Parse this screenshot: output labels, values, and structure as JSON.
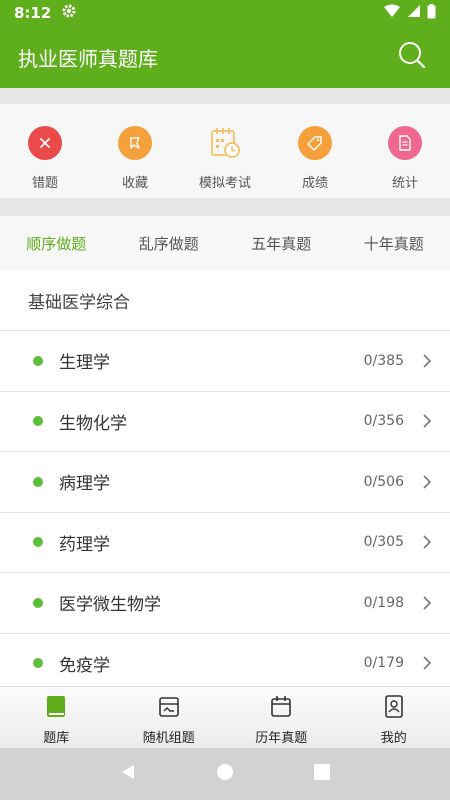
{
  "status_bar": {
    "time": "8:12"
  },
  "app_bar": {
    "title": "执业医师真题库"
  },
  "quick_actions": [
    {
      "label": "错题",
      "icon": "close-icon",
      "color": "#ea4a4a"
    },
    {
      "label": "收藏",
      "icon": "bookmark-icon",
      "color": "#f5a03a"
    },
    {
      "label": "模拟考试",
      "icon": "calendar-clock-icon",
      "color": "#f5c065"
    },
    {
      "label": "成绩",
      "icon": "tag-icon",
      "color": "#f5a03a"
    },
    {
      "label": "统计",
      "icon": "document-icon",
      "color": "#f0688f"
    }
  ],
  "tabs": [
    "顺序做题",
    "乱序做题",
    "五年真题",
    "十年真题"
  ],
  "active_tab": 0,
  "section": {
    "title": "基础医学综合"
  },
  "subjects": [
    {
      "name": "生理学",
      "count": "0/385"
    },
    {
      "name": "生物化学",
      "count": "0/356"
    },
    {
      "name": "病理学",
      "count": "0/506"
    },
    {
      "name": "药理学",
      "count": "0/305"
    },
    {
      "name": "医学微生物学",
      "count": "0/198"
    },
    {
      "name": "免疫学",
      "count": "0/179"
    }
  ],
  "bottom_nav": [
    {
      "label": "题库",
      "icon": "book-icon",
      "active": true
    },
    {
      "label": "随机组题",
      "icon": "card-icon",
      "active": false
    },
    {
      "label": "历年真题",
      "icon": "calendar-icon",
      "active": false
    },
    {
      "label": "我的",
      "icon": "contact-book-icon",
      "active": false
    }
  ],
  "colors": {
    "primary": "#5fae1c",
    "dot": "#5bbf3a"
  }
}
